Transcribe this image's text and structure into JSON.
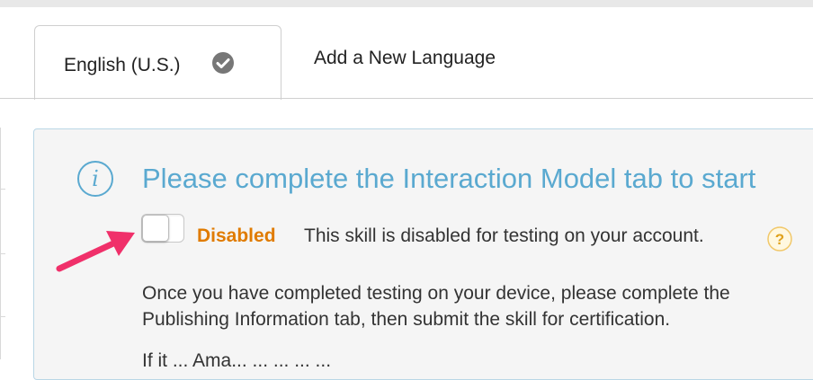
{
  "tabs": {
    "active_label": "English (U.S.)",
    "add_label": "Add a New Language"
  },
  "panel": {
    "heading": "Please complete the Interaction Model tab to start",
    "toggle_state": "off",
    "status_label": "Disabled",
    "status_description": "This skill is disabled for testing on your account.",
    "paragraph_line1": "Once you have completed testing on your device, please complete the",
    "paragraph_line2": "Publishing Information tab, then submit the skill for certification.",
    "paragraph_partial": "If it ... Ama... ... ... ... ..."
  },
  "icons": {
    "info": "info-icon",
    "check": "check-circle-icon",
    "help": "question-mark-icon",
    "annotation": "pointer-arrow-icon"
  },
  "colors": {
    "heading": "#5aa9d0",
    "status": "#e07b00",
    "arrow": "#f0306a",
    "panel_bg": "#f5f5f5",
    "panel_border": "#b9d6e6"
  }
}
